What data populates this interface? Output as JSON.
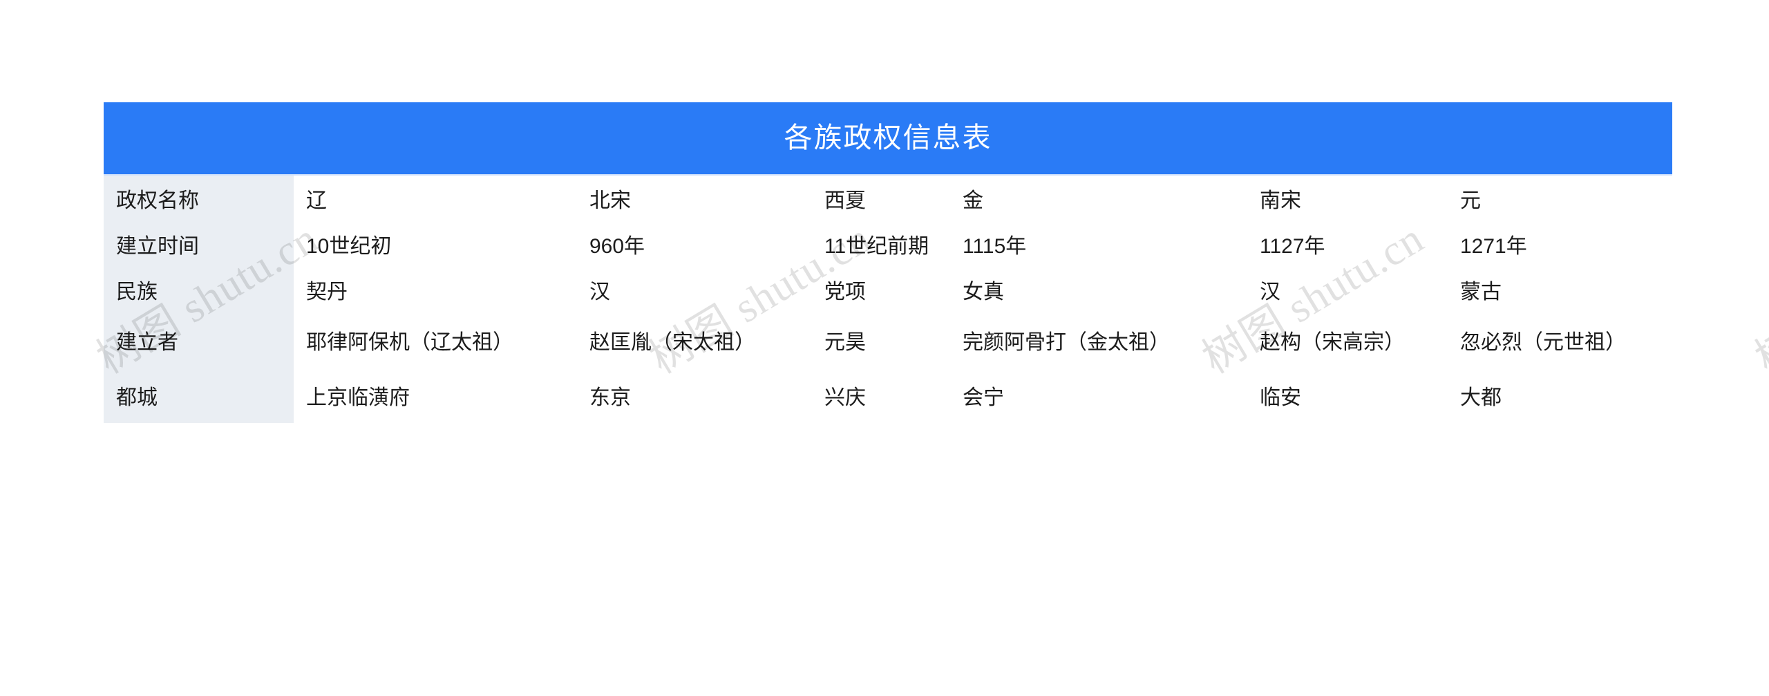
{
  "title": "各族政权信息表",
  "theme": {
    "header_bg": "#2a7bf6",
    "header_text": "#ffffff",
    "rowhead_bg": "#eaeef3",
    "body_text": "#1c1c1c",
    "page_bg": "#ffffff"
  },
  "watermark": {
    "text": "树图 shutu.cn"
  },
  "table": {
    "row_headers": [
      "政权名称",
      "建立时间",
      "民族",
      "建立者",
      "都城"
    ],
    "rows": [
      {
        "header": "政权名称",
        "cells": [
          "辽",
          "北宋",
          "西夏",
          "金",
          "南宋",
          "元"
        ]
      },
      {
        "header": "建立时间",
        "cells": [
          "10世纪初",
          "960年",
          "11世纪前期",
          "1115年",
          "1127年",
          "1271年"
        ]
      },
      {
        "header": "民族",
        "cells": [
          "契丹",
          "汉",
          "党项",
          "女真",
          "汉",
          "蒙古"
        ]
      },
      {
        "header": "建立者",
        "cells": [
          "耶律阿保机（辽太祖）",
          "赵匡胤（宋太祖）",
          "元昊",
          "完颜阿骨打（金太祖）",
          "赵构（宋高宗）",
          "忽必烈（元世祖）"
        ]
      },
      {
        "header": "都城",
        "cells": [
          "上京临潢府",
          "东京",
          "兴庆",
          "会宁",
          "临安",
          "大都"
        ]
      }
    ]
  }
}
